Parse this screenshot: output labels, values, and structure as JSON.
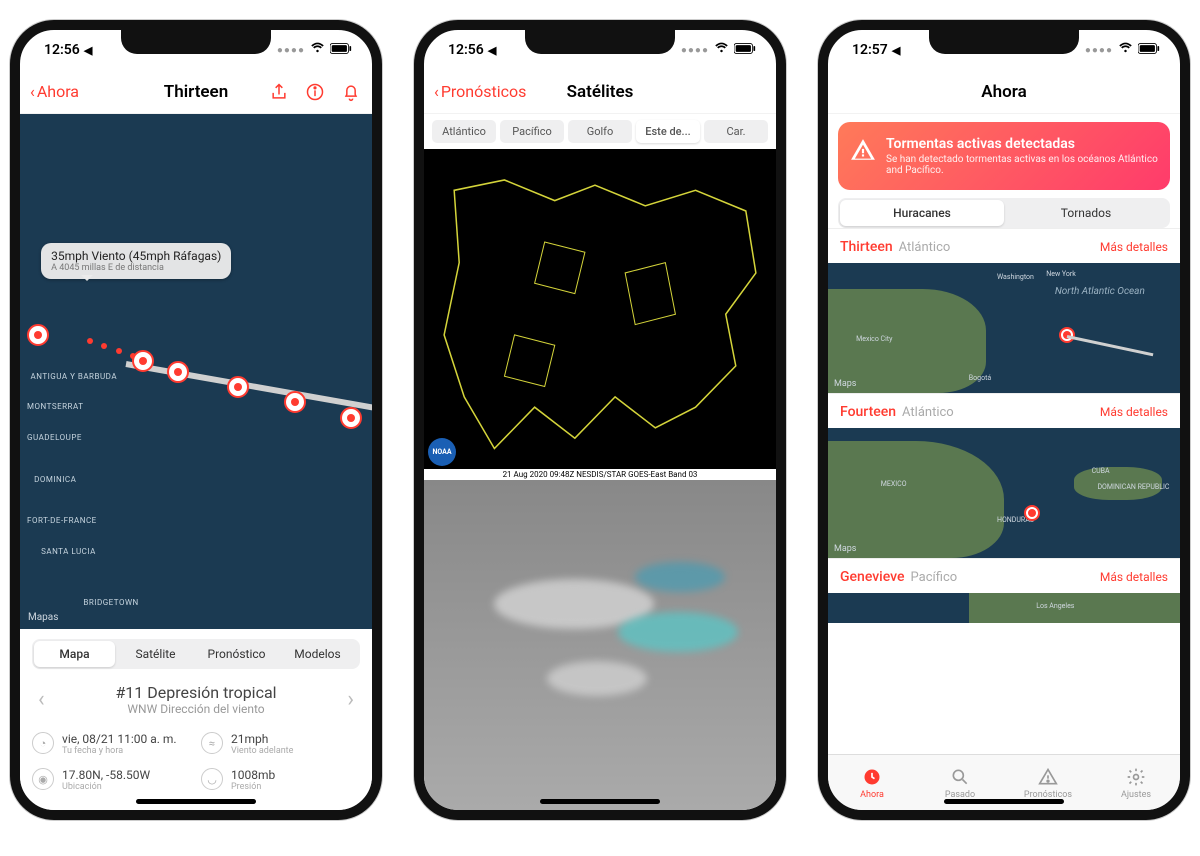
{
  "screen1": {
    "status_time": "12:56",
    "nav": {
      "back": "Ahora",
      "title": "Thirteen"
    },
    "callout": {
      "title": "35mph Viento (45mph Ráfagas)",
      "sub": "A 4045 millas E de distancia"
    },
    "islands": [
      "ANTIGUA Y BARBUDA",
      "MONTSERRAT",
      "GUADELOUPE",
      "DOMINICA",
      "Fort-de-France",
      "SANTA LUCIA",
      "Bridgetown"
    ],
    "maps_attrib": "Mapas",
    "tabs": [
      "Mapa",
      "Satélite",
      "Pronóstico",
      "Modelos"
    ],
    "storm": {
      "title": "#11 Depresión tropical",
      "sub": "WNW Dirección del viento"
    },
    "info": {
      "datetime": {
        "val": "vie, 08/21 11:00 a. m.",
        "lbl": "Tu fecha y hora"
      },
      "wind": {
        "val": "21mph",
        "lbl": "Viento adelante"
      },
      "loc": {
        "val": "17.80N, -58.50W",
        "lbl": "Ubicación"
      },
      "pressure": {
        "val": "1008mb",
        "lbl": "Presión"
      }
    }
  },
  "screen2": {
    "status_time": "12:56",
    "nav": {
      "back": "Pronósticos",
      "title": "Satélites"
    },
    "tabs": [
      "Atlántico",
      "Pacífico",
      "Golfo",
      "Este de...",
      "Car."
    ],
    "caption": "21 Aug 2020 09:48Z NESDIS/STAR GOES-East Band 03",
    "noaa": "NOAA"
  },
  "screen3": {
    "status_time": "12:57",
    "nav": {
      "title": "Ahora"
    },
    "alert": {
      "title": "Tormentas activas detectadas",
      "sub": "Se han detectado tormentas activas en los océanos Atlántico and Pacífico."
    },
    "seg": [
      "Huracanes",
      "Tornados"
    ],
    "storms": [
      {
        "name": "Thirteen",
        "ocean": "Atlántico",
        "more": "Más detalles",
        "ocean_label": "North Atlantic Ocean",
        "countries": [
          "Mexico City",
          "Washington",
          "New York",
          "Bogotá"
        ]
      },
      {
        "name": "Fourteen",
        "ocean": "Atlántico",
        "more": "Más detalles",
        "countries": [
          "MEXICO",
          "CUBA",
          "DOMINICAN REPUBLIC",
          "HONDURAS"
        ]
      },
      {
        "name": "Genevieve",
        "ocean": "Pacífico",
        "more": "Más detalles",
        "countries": [
          "Los Angeles"
        ]
      }
    ],
    "maps_attrib": "Maps",
    "tabbar": [
      {
        "label": "Ahora"
      },
      {
        "label": "Pasado"
      },
      {
        "label": "Pronósticos"
      },
      {
        "label": "Ajustes"
      }
    ]
  }
}
